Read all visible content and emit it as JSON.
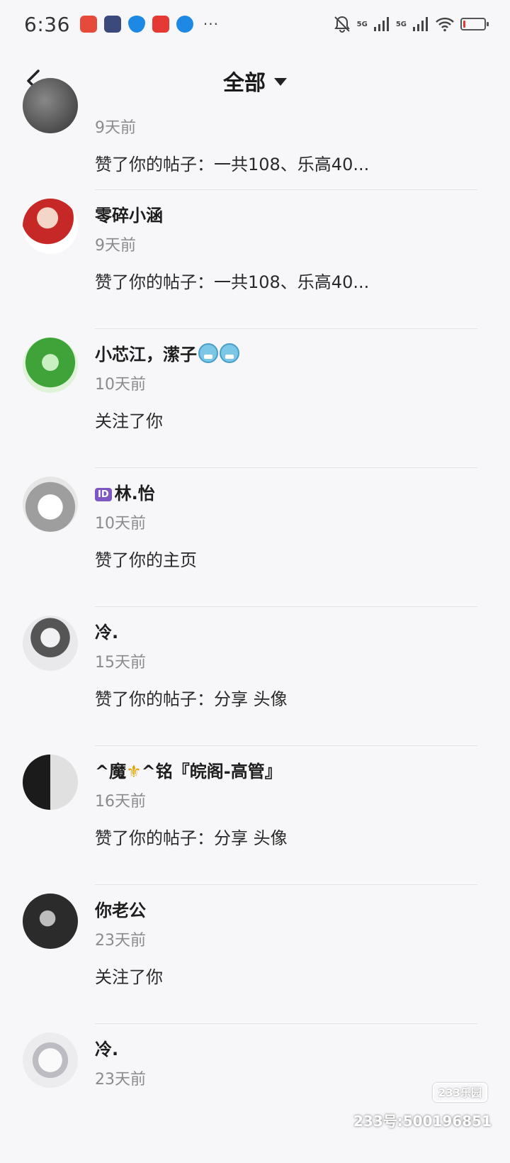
{
  "status_bar": {
    "time": "6:36",
    "more": "···",
    "net1": "5G",
    "net2": "5G",
    "battery_level": 0.12,
    "app_icons": [
      "call-app-icon",
      "settings-app-icon",
      "shield-app-icon",
      "heart-app-icon",
      "browser-app-icon"
    ],
    "app_colors": [
      "#e64a3b",
      "#3b4a7a",
      "#1e88e5",
      "#e53935",
      "#1e88e5"
    ]
  },
  "nav": {
    "title": "全部"
  },
  "notifications": [
    {
      "name": "",
      "time": "9天前",
      "action": "赞了你的帖子：一共108、乐高40...",
      "avatar_color": "#555"
    },
    {
      "name": "零碎小涵",
      "time": "9天前",
      "action": "赞了你的帖子：一共108、乐高40...",
      "avatar_color": "#c62828"
    },
    {
      "name": "小芯江，潆子",
      "time": "10天前",
      "action": "关注了你",
      "avatar_color": "#43a047"
    },
    {
      "name": "林.怡",
      "badge": "ID",
      "time": "10天前",
      "action": "赞了你的主页",
      "avatar_color": "#9e9e9e"
    },
    {
      "name": "冷.",
      "time": "15天前",
      "action": "赞了你的帖子：分享 头像",
      "avatar_color": "#cfcfd4"
    },
    {
      "name_prefix": "^魔",
      "name_suffix": "^铭『皖阁-高管』",
      "time": "16天前",
      "action": "赞了你的帖子：分享 头像",
      "avatar_color": "#3a3a3a"
    },
    {
      "name": "你老公",
      "time": "23天前",
      "action": "关注了你",
      "avatar_color": "#2b2b2b"
    },
    {
      "name": "冷.",
      "time": "23天前",
      "action": "",
      "avatar_color": "#d8d8dc"
    }
  ],
  "watermark": {
    "logo": "233乐园",
    "text": "233号:500196851"
  }
}
